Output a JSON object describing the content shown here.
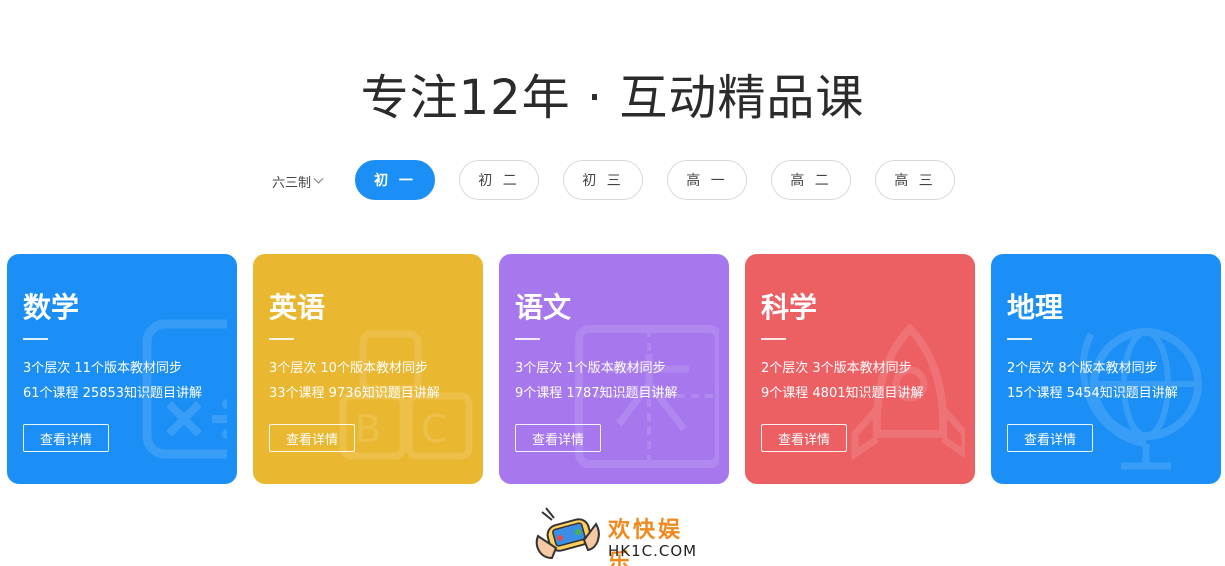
{
  "header": {
    "title": "专注12年 · 互动精品课"
  },
  "filters": {
    "system_label": "六三制",
    "grades": [
      {
        "label": "初 一",
        "active": true
      },
      {
        "label": "初 二",
        "active": false
      },
      {
        "label": "初 三",
        "active": false
      },
      {
        "label": "高 一",
        "active": false
      },
      {
        "label": "高 二",
        "active": false
      },
      {
        "label": "高 三",
        "active": false
      }
    ]
  },
  "cards": [
    {
      "subject": "数学",
      "line1": "3个层次  11个版本教材同步",
      "line2": "61个课程  25853知识题目讲解",
      "button": "查看详情",
      "color": "#1b8ff5",
      "icon": "math-symbols-icon"
    },
    {
      "subject": "英语",
      "line1": "3个层次  10个版本教材同步",
      "line2": "33个课程  9736知识题目讲解",
      "button": "查看详情",
      "color": "#eab730",
      "icon": "abc-blocks-icon"
    },
    {
      "subject": "语文",
      "line1": "3个层次  1个版本教材同步",
      "line2": "9个课程  1787知识题目讲解",
      "button": "查看详情",
      "color": "#a677ed",
      "icon": "character-grid-icon"
    },
    {
      "subject": "科学",
      "line1": "2个层次  3个版本教材同步",
      "line2": "9个课程  4801知识题目讲解",
      "button": "查看详情",
      "color": "#ec5f63",
      "icon": "rocket-icon"
    },
    {
      "subject": "地理",
      "line1": "2个层次  8个版本教材同步",
      "line2": "15个课程  5454知识题目讲解",
      "button": "查看详情",
      "color": "#1b8ff5",
      "icon": "globe-icon"
    }
  ],
  "footer": {
    "brand_cn": "欢快娱乐",
    "brand_en": "HK1C.COM",
    "icon": "gamepad-hands-icon"
  }
}
